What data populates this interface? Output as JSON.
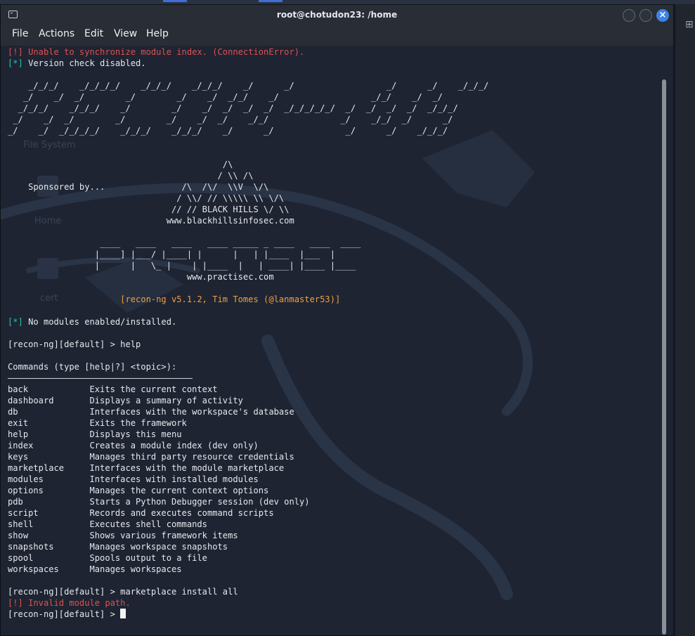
{
  "window": {
    "title": "root@chotudon23: /home",
    "close_glyph": "×"
  },
  "menu": [
    "File",
    "Actions",
    "Edit",
    "View",
    "Help"
  ],
  "desktop_icons": [
    "File System",
    "Home",
    "cert"
  ],
  "terminal": {
    "lines": [
      {
        "text": "[!] Unable to synchronize module index. (ConnectionError).",
        "style": "red"
      },
      {
        "parts": [
          {
            "text": "[*]",
            "style": "cyan"
          },
          {
            "text": " Version check disabled.",
            "style": "dim"
          }
        ]
      },
      {
        "text": ""
      },
      {
        "text": "    _/_/_/    _/_/_/_/    _/_/_/    _/_/_/    _/      _/                  _/      _/    _/_/_/"
      },
      {
        "text": "   _/    _/  _/        _/        _/    _/  _/_/    _/                  _/_/    _/  _/"
      },
      {
        "text": "  _/_/_/    _/_/_/    _/        _/    _/  _/  _/  _/  _/_/_/_/_/  _/  _/  _/  _/  _/_/_/"
      },
      {
        "text": " _/    _/  _/        _/        _/    _/  _/    _/_/              _/    _/_/  _/      _/"
      },
      {
        "text": "_/    _/  _/_/_/_/    _/_/_/    _/_/_/    _/      _/              _/      _/    _/_/_/"
      },
      {
        "text": ""
      },
      {
        "text": ""
      },
      {
        "text": "                                          /\\"
      },
      {
        "text": "                                         / \\\\ /\\"
      },
      {
        "text": "    Sponsored by...               /\\  /\\/  \\\\V  \\/\\"
      },
      {
        "text": "                                 / \\\\/ // \\\\\\\\\\ \\\\ \\/\\"
      },
      {
        "text": "                                // // BLACK HILLS \\/ \\\\"
      },
      {
        "text": "                               www.blackhillsinfosec.com"
      },
      {
        "text": ""
      },
      {
        "text": "                  ____   ____   ____   ____ _____ _ ____   ____  ____"
      },
      {
        "text": "                 |____] |___/ |____| |      |   | |____  |___  |"
      },
      {
        "text": "                 |      |   \\_ |    | |____  |   | ____| |____ |____"
      },
      {
        "text": "                                   www.practisec.com"
      },
      {
        "text": ""
      },
      {
        "text": "                      [recon-ng v5.1.2, Tim Tomes (@lanmaster53)]",
        "style": "orange"
      },
      {
        "text": ""
      },
      {
        "parts": [
          {
            "text": "[*]",
            "style": "cyan"
          },
          {
            "text": " No modules enabled/installed.",
            "style": "dim"
          }
        ]
      },
      {
        "text": ""
      },
      {
        "text": "[recon-ng][default] > help"
      },
      {
        "text": ""
      },
      {
        "text": "Commands (type [help|?] <topic>):"
      },
      {
        "rule": true
      },
      {
        "text": "back            Exits the current context"
      },
      {
        "text": "dashboard       Displays a summary of activity"
      },
      {
        "text": "db              Interfaces with the workspace's database"
      },
      {
        "text": "exit            Exits the framework"
      },
      {
        "text": "help            Displays this menu"
      },
      {
        "text": "index           Creates a module index (dev only)"
      },
      {
        "text": "keys            Manages third party resource credentials"
      },
      {
        "text": "marketplace     Interfaces with the module marketplace"
      },
      {
        "text": "modules         Interfaces with installed modules"
      },
      {
        "text": "options         Manages the current context options"
      },
      {
        "text": "pdb             Starts a Python Debugger session (dev only)"
      },
      {
        "text": "script          Records and executes command scripts"
      },
      {
        "text": "shell           Executes shell commands"
      },
      {
        "text": "show            Shows various framework items"
      },
      {
        "text": "snapshots       Manages workspace snapshots"
      },
      {
        "text": "spool           Spools output to a file"
      },
      {
        "text": "workspaces      Manages workspaces"
      },
      {
        "text": ""
      },
      {
        "text": "[recon-ng][default] > marketplace install all"
      },
      {
        "text": "[!] Invalid module path.",
        "style": "red"
      },
      {
        "text": "[recon-ng][default] > ",
        "cursor": true
      }
    ]
  },
  "colors": {
    "red": "#e05050",
    "cyan": "#2ac3b0",
    "orange": "#f0a040",
    "close_button": "#3d82e6"
  }
}
